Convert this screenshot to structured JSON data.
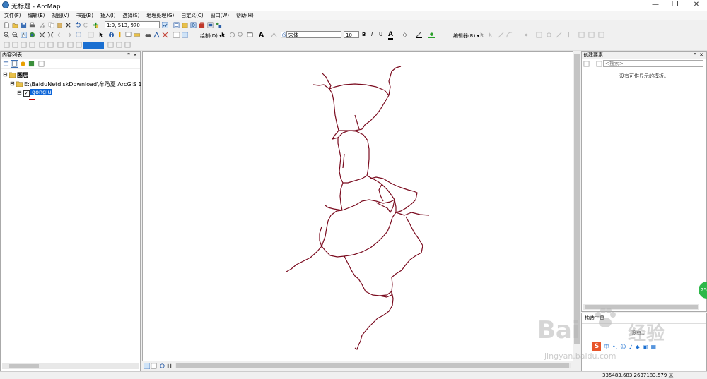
{
  "window": {
    "title": "无标题 - ArcMap",
    "controls": [
      "—",
      "❐",
      "✕"
    ]
  },
  "menu": [
    "文件(F)",
    "编辑(E)",
    "视图(V)",
    "书签(B)",
    "插入(I)",
    "选择(S)",
    "地理处理(G)",
    "自定义(C)",
    "窗口(W)",
    "帮助(H)"
  ],
  "toolbar": {
    "scale": "1:9, 513, 970",
    "draw_label": "绘制(D) ▾",
    "font": "宋体",
    "font_size": "10",
    "bold": "B",
    "italic": "I",
    "underline": "U",
    "editor_label": "编辑器(R) ▾"
  },
  "toc": {
    "header": "内容列表",
    "layers_root": "图层",
    "folder_path": "E:\\BaiduNetdiskDownload\\牟乃夏 ArcGIS 10",
    "layer_name": "gonglu",
    "legend_color": "#c00000"
  },
  "create_features": {
    "header": "创建要素",
    "search_placeholder": "<搜索>",
    "empty_message": "没有可供显示的模板。",
    "construction_tools": "构造工具",
    "tools_empty": "没有..."
  },
  "status": {
    "coordinates": "335483.683  2637183.579 米"
  },
  "overlay": {
    "badge_text": "25",
    "watermark_text": "Bai",
    "watermark_suffix": "经验",
    "watermark_url": "jingyan.baidu.com"
  },
  "colors": {
    "road": "#7a0a1e",
    "accent": "#1a6fd1",
    "selection": "#0a64d8"
  }
}
